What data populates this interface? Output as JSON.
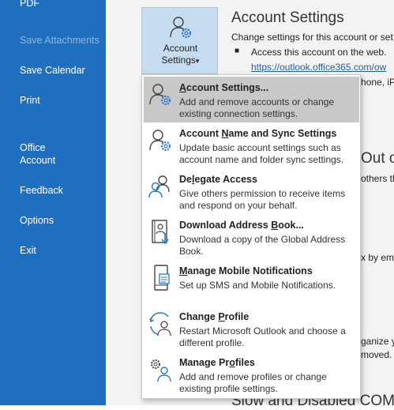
{
  "sidebar": {
    "items": [
      {
        "label": "Save Attachments",
        "enabled": false
      },
      {
        "label": "Save Calendar",
        "enabled": true
      },
      {
        "label": "Print",
        "enabled": true
      },
      {
        "label": "Office\nAccount",
        "enabled": true
      },
      {
        "label": "Feedback",
        "enabled": true
      },
      {
        "label": "Options",
        "enabled": true
      },
      {
        "label": "Exit",
        "enabled": true
      }
    ],
    "top_partial": "PDF"
  },
  "account_button": {
    "label": "Account\nSettings",
    "chevron": "▾"
  },
  "panel": {
    "heading": "Account Settings",
    "subtext": "Change settings for this account or set",
    "bullet": "Access this account on the web.",
    "link": "https://outlook.office365.com/ow",
    "partial_phone": "hone, iP",
    "partial_out_of": "Out of",
    "partial_others": "others th",
    "partial_x_by": "x by em",
    "partial_ganize": "ganize yo",
    "partial_moved": "moved.",
    "partial_slow": "Slow and Disabled COM A"
  },
  "menu": {
    "items": [
      {
        "title": "Account Settings...",
        "underline_char": "A",
        "desc": "Add and remove accounts or change existing connection settings.",
        "icon": "account-settings-icon",
        "selected": true
      },
      {
        "title": "Account Name and Sync Settings",
        "underline_char": "N",
        "desc": "Update basic account settings such as account name and folder sync settings.",
        "icon": "account-sync-icon",
        "selected": false
      },
      {
        "title": "Delegate Access",
        "underline_char": "l",
        "desc": "Give others permission to receive items and respond on your behalf.",
        "icon": "delegate-access-icon",
        "selected": false
      },
      {
        "title": "Download Address Book...",
        "underline_char": "B",
        "desc": "Download a copy of the Global Address Book.",
        "icon": "download-address-book-icon",
        "selected": false
      },
      {
        "title": "Manage Mobile Notifications",
        "underline_char": "M",
        "desc": "Set up SMS and Mobile Notifications.",
        "icon": "mobile-notifications-icon",
        "selected": false
      },
      {
        "title": "Change Profile",
        "underline_char": "P",
        "desc": "Restart Microsoft Outlook and choose a different profile.",
        "icon": "change-profile-icon",
        "selected": false
      },
      {
        "title": "Manage Profiles",
        "underline_char": "o",
        "desc": "Add and remove profiles or change existing profile settings.",
        "icon": "manage-profiles-icon",
        "selected": false
      }
    ]
  },
  "colors": {
    "sidebar": "#1f6fc0",
    "accent_blue": "#2b79c2",
    "selected": "#c8c8c8"
  }
}
